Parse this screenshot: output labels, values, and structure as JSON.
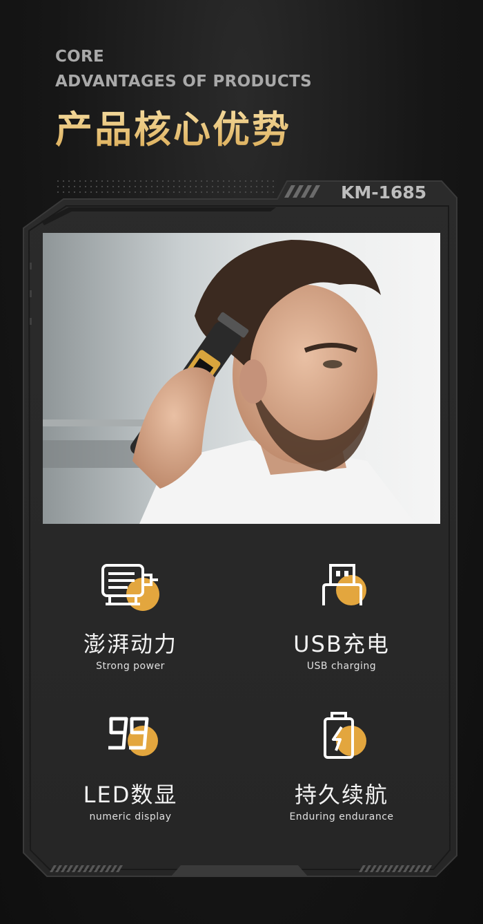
{
  "header": {
    "en_line1": "CORE",
    "en_line2": "ADVANTAGES OF PRODUCTS",
    "zh_title": "产品核心优势"
  },
  "model": "KM-1685",
  "colors": {
    "accent": "#e3a63e",
    "frame": "#2d2d2d",
    "frame_stroke": "#3d3d3d",
    "text": "#f2f2f2"
  },
  "features": [
    {
      "icon": "motor-icon",
      "title": "澎湃动力",
      "subtitle": "Strong power"
    },
    {
      "icon": "usb-icon",
      "title": "USB充电",
      "subtitle": "USB charging"
    },
    {
      "icon": "led-digits-icon",
      "title": "LED数显",
      "subtitle": "numeric display"
    },
    {
      "icon": "battery-icon",
      "title": "持久续航",
      "subtitle": "Enduring endurance"
    }
  ]
}
